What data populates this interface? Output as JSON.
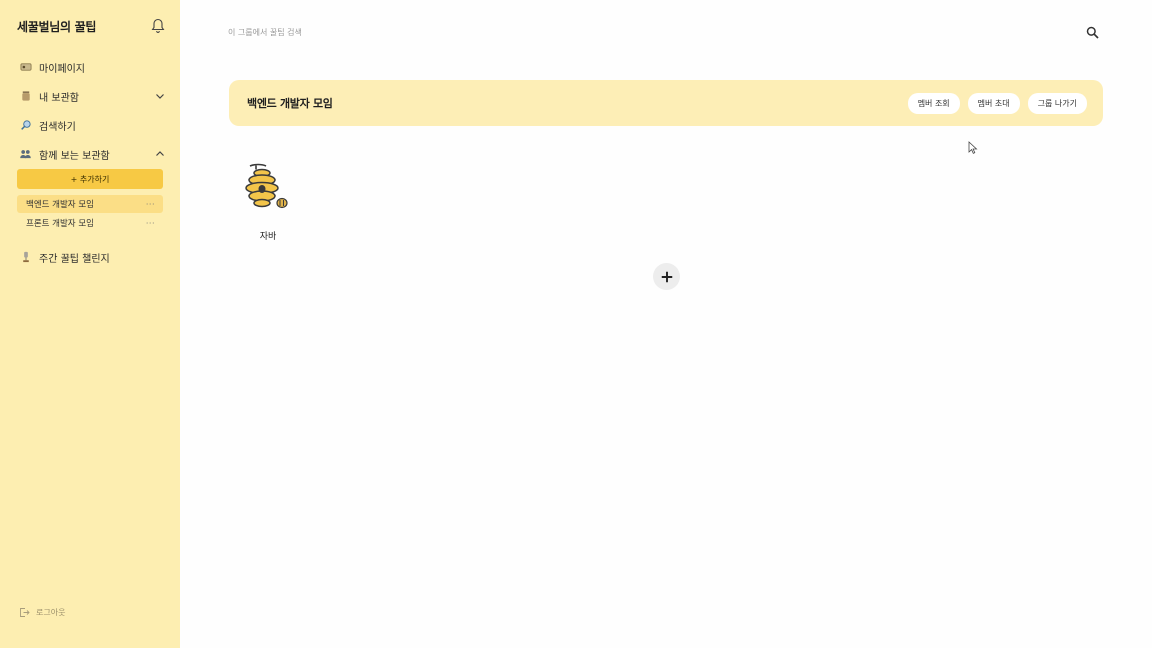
{
  "sidebar": {
    "title": "세꿀벌님의 꿀팁",
    "nav": {
      "mypage": "마이페이지",
      "my_storage": "내 보관함",
      "search": "검색하기",
      "shared_storage": "함께 보는 보관함",
      "add_button": "+ 추가하기",
      "groups": [
        {
          "label": "백엔드 개발자 모임",
          "more": "···",
          "active": true
        },
        {
          "label": "프론트 개발자 모임",
          "more": "···",
          "active": false
        }
      ],
      "challenge": "주간 꿀팁 챌린지"
    },
    "logout": "로그아웃"
  },
  "main": {
    "search_placeholder": "이 그룹에서 꿀팁 검색",
    "group": {
      "title": "백엔드 개발자 모임",
      "actions": {
        "view_members": "멤버 조회",
        "invite_members": "멤버 초대",
        "leave_group": "그룹 나가기"
      }
    },
    "folders": [
      {
        "label": "자바",
        "icon": "beehive-icon"
      }
    ]
  },
  "colors": {
    "sidebar_bg": "#fdeeb1",
    "accent": "#f7c944",
    "group_bar_bg": "#fdeeb6"
  }
}
